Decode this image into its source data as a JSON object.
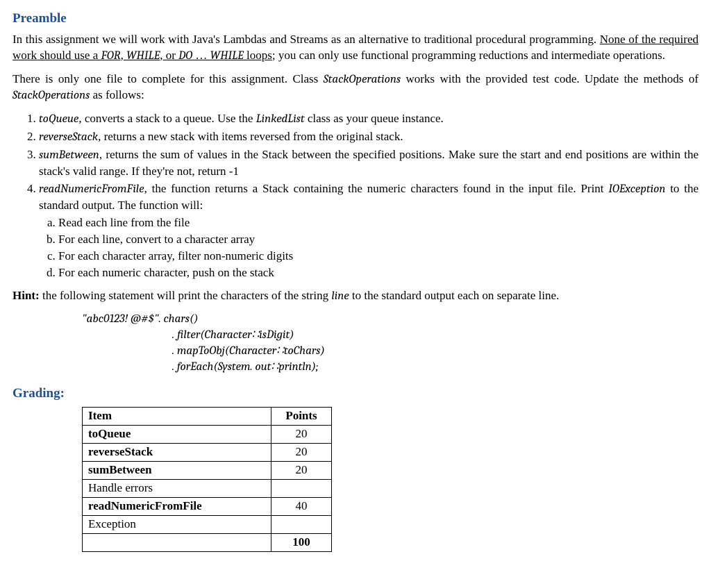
{
  "headings": {
    "preamble": "Preamble",
    "grading": "Grading:"
  },
  "para1_parts": {
    "p1a": "In this assignment we will work with Java's Lambdas and Streams as an alternative to traditional procedural programming. ",
    "p1b_underline_prefix": "None of the required work should use a ",
    "p1b_for": "FOR",
    "p1b_mid1": ", ",
    "p1b_while": "WHILE",
    "p1b_mid2": ", or ",
    "p1b_do": "DO",
    "p1b_dots": " … ",
    "p1b_while2": "WHILE",
    "p1b_underline_suffix": " loops",
    "p1c": "; you can only use functional programming reductions and intermediate operations."
  },
  "para2_parts": {
    "p2a": "There is only one file to complete for this assignment. Class ",
    "p2b": "StackOperations",
    "p2c": " works with the provided test code. Update the methods of ",
    "p2d": "StackOperations",
    "p2e": " as follows:"
  },
  "list": {
    "item1": {
      "code": "toQueue",
      "mid": ", converts a stack to a queue. Use the ",
      "class": "LinkedList",
      "tail": " class as your queue instance."
    },
    "item2": {
      "code": "reverseStack",
      "tail": ", returns a new stack with items reversed from the original stack."
    },
    "item3": {
      "code": "sumBetween",
      "tail": ", returns the sum of values in the Stack between the specified positions. Make sure the start and end positions are within the stack's valid range. If they're not, return -1"
    },
    "item4": {
      "code": "readNumericFromFile",
      "mid": ", the function returns a Stack containing the numeric characters found in the input file. Print ",
      "exc": "IOException",
      "tail": " to the standard output. The function will:",
      "sub": {
        "a": "Read each line from the file",
        "b": "For each line, convert to a character array",
        "c": "For each character array, filter non-numeric digits",
        "d": "For each numeric character, push on the stack"
      }
    }
  },
  "hint": {
    "label": "Hint:",
    "text_a": " the following statement will print the characters of the string ",
    "line_word": "line",
    "text_b": " to the standard output each on separate line."
  },
  "code": {
    "l1a": "\"abc0123! @#$\"",
    "l1b": ". chars()",
    "l2": ". filter(Character∷isDigit)",
    "l3": ". mapToObj(Character∷toChars)",
    "l4": ". forEach(System. out∷println);"
  },
  "table": {
    "headers": {
      "item": "Item",
      "points": "Points"
    },
    "rows": [
      {
        "item": "toQueue",
        "points": "20",
        "bold": true
      },
      {
        "item": "reverseStack",
        "points": "20",
        "bold": true
      },
      {
        "item": "sumBetween",
        "points": "20",
        "bold": true
      },
      {
        "item": "Handle errors",
        "points": "",
        "indent": true
      },
      {
        "item": "readNumericFromFile",
        "points": "40",
        "bold": true
      },
      {
        "item": "Exception",
        "points": "",
        "indent": true
      }
    ],
    "total": "100"
  }
}
